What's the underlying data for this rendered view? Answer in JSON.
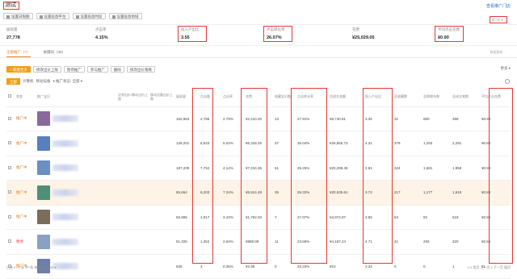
{
  "title": "测试",
  "top_link": "查看推广门店",
  "toolbar": [
    {
      "label": "设置日限额",
      "icon": "calendar-icon"
    },
    {
      "label": "设置投放平台",
      "icon": "platform-icon"
    },
    {
      "label": "设置投放时段",
      "icon": "clock-icon"
    },
    {
      "label": "设置投放地域",
      "icon": "map-icon"
    }
  ],
  "date_range": "近7天 ▾",
  "metrics": [
    {
      "label": "展现量",
      "value": "27,778"
    },
    {
      "label": "点击率",
      "value": "4.15%"
    },
    {
      "label": "投入产出比",
      "value": "3.55"
    },
    {
      "label": "点击转化率",
      "value": "26.07%"
    },
    {
      "label": "花费",
      "value": "¥25,029.05"
    },
    {
      "label": "平均点击花费",
      "value": "¥0.90"
    }
  ],
  "note": "数据更新...",
  "tabs": [
    {
      "label": "全部推广（7）"
    },
    {
      "label": "关键词（30）"
    }
  ],
  "actions": [
    "+ 新建宝贝",
    "修改出价上限",
    "暂停推广",
    "参与推广",
    "删除",
    "修改出价策略"
  ],
  "more": "更多 ▾",
  "filters": {
    "all": "全部",
    "pc": "计算机",
    "mobile": "移动设备",
    "status": "▾ 推广状态: 全部 ▾"
  },
  "headers": [
    "",
    "状态",
    "推广宝贝",
    "计划出价/移动出价上限",
    "移动设备出价上限",
    "展现量",
    "点击量",
    "点击率",
    "花费",
    "收藏宝贝数",
    "点击转化率",
    "总成交金额",
    "投入产出比",
    "总收藏数",
    "总购物车数",
    "总成交笔数",
    "平均点击花费"
  ],
  "rows": [
    {
      "status": "推广中",
      "status_red": false,
      "thumb": "#8a6a9e",
      "cells": [
        "162,953",
        "2,785",
        "2.79%",
        "¥2,410.20",
        "13",
        "27.91%",
        "¥8,740.61",
        "3.35",
        "31",
        "680",
        "389",
        "¥0.93"
      ]
    },
    {
      "status": "推广中",
      "status_red": false,
      "thumb": "#5a7fbf",
      "cells": [
        "128,201",
        "6,933",
        "5.02%",
        "¥5,328.25",
        "37",
        "35.04%",
        "¥26,855.73",
        "4.31",
        "379",
        "1,293",
        "2,291",
        "¥0.84"
      ]
    },
    {
      "status": "推广中",
      "status_red": false,
      "thumb": "#6c8fc2",
      "cells": [
        "187,209",
        "7,752",
        "4.14%",
        "¥7,234.36",
        "51",
        "25.26%",
        "¥20,299.45",
        "2.81",
        "324",
        "1,581",
        "1,958",
        "¥0.93"
      ]
    },
    {
      "status": "推广中",
      "status_red": false,
      "thumb": "#4f8f7a",
      "cells": [
        "85,664",
        "6,203",
        "7.24%",
        "¥5,524.49",
        "35",
        "26.32%",
        "¥20,535.61",
        "3.72",
        "217",
        "1,177",
        "1,619",
        "¥0.89"
      ]
    },
    {
      "status": "推广中",
      "status_red": false,
      "thumb": "#7a6e5a",
      "cells": [
        "55,996",
        "1,917",
        "3.43%",
        "¥1,762.03",
        "7",
        "27.07%",
        "¥4,972.87",
        "3.95",
        "53",
        "92",
        "518",
        "¥0.92"
      ]
    },
    {
      "status": "暂停",
      "status_red": true,
      "thumb": "#8aa1c4",
      "cells": [
        "51,326",
        "1,352",
        "2.64%",
        "¥888.09",
        "11",
        "23.66%",
        "¥4,187.24",
        "4.71",
        "41",
        "293",
        "320",
        "¥0.66"
      ]
    },
    {
      "status": "推广中",
      "status_red": false,
      "thumb": "#6b7fa8",
      "cells": [
        "845",
        "3",
        "0.36%",
        "¥2.95",
        "0",
        "33.33%",
        "¥10",
        "3.34",
        "0",
        "0",
        "1",
        "¥1"
      ]
    }
  ],
  "pager_left": "已选 0 / 7 条   共7条   每页显示 200 ▾",
  "pager_right": "1/1  首页  上一页  1  下一页  尾页"
}
